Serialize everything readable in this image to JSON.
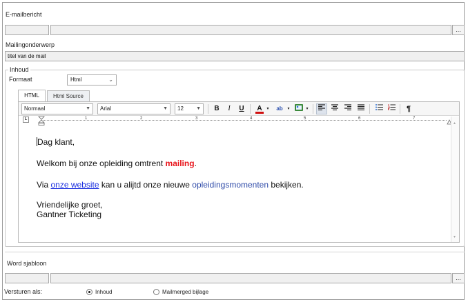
{
  "email": {
    "section_label": "E-mailbericht",
    "browse_label": "..."
  },
  "subject": {
    "label": "Mailingonderwerp",
    "value": "titel van de mail"
  },
  "content": {
    "group_label": "Inhoud",
    "format_label": "Formaat",
    "format_value": "Html",
    "tabs": [
      {
        "label": "HTML",
        "active": true
      },
      {
        "label": "Html Source",
        "active": false
      }
    ],
    "toolbar": {
      "style_value": "Normaal",
      "font_value": "Arial",
      "size_value": "12",
      "bold": "B",
      "italic": "I",
      "underline": "U",
      "font_color": "A",
      "highlight": "ab",
      "paragraph_mark": "¶"
    },
    "ruler_numbers": [
      "1",
      "2",
      "3",
      "4",
      "5",
      "6",
      "7"
    ],
    "ruler_tab_marker": "L",
    "body": {
      "greeting": "Dag klant,",
      "line2_pre": "Welkom bij onze opleiding omtrent ",
      "line2_bold": "mailing",
      "line2_post": ".",
      "line3_pre": "Via ",
      "line3_link": "onze website",
      "line3_mid": " kan u alijtd onze nieuwe ",
      "line3_blue": "opleidingsmomenten",
      "line3_post": " bekijken.",
      "closing": "Vriendelijke groet,",
      "signature": "Gantner Ticketing"
    }
  },
  "template": {
    "label": "Word sjabloon",
    "browse_label": "..."
  },
  "send_as": {
    "label": "Versturen als:",
    "options": [
      {
        "label": "Inhoud",
        "selected": true
      },
      {
        "label": "Mailmerged bijlage",
        "selected": false
      }
    ]
  },
  "colors": {
    "bold_red": "#e8141b",
    "link_blue": "#1b2fe0",
    "muted_blue": "#2e4aa8",
    "font_color_bar": "#d01010"
  }
}
